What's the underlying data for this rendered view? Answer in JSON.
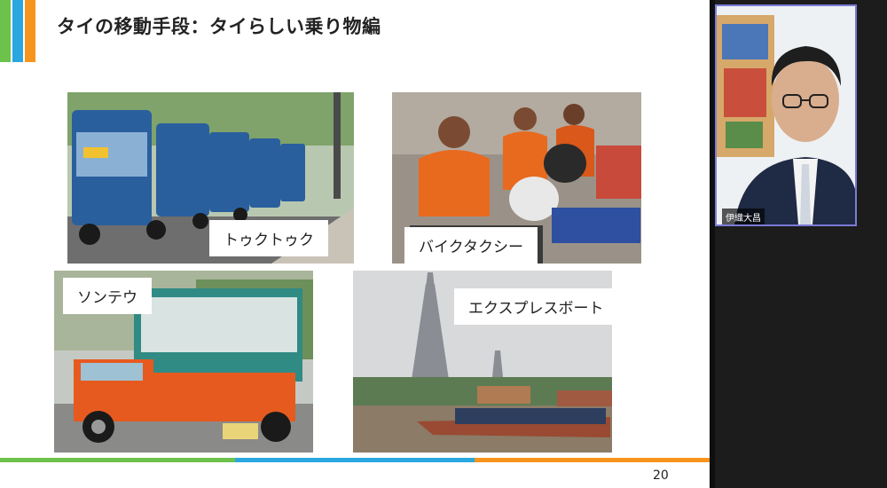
{
  "slide": {
    "title": "タイの移動手段：タイらしい乗り物編",
    "page_number": "20",
    "accent_colors": [
      "#6cc24a",
      "#2aa7e0",
      "#f7941d"
    ],
    "photos": [
      {
        "label": "トゥクトゥク"
      },
      {
        "label": "バイクタクシー"
      },
      {
        "label": "ソンテウ"
      },
      {
        "label": "エクスプレスボート"
      }
    ]
  },
  "participant": {
    "name": "伊織大昌"
  }
}
